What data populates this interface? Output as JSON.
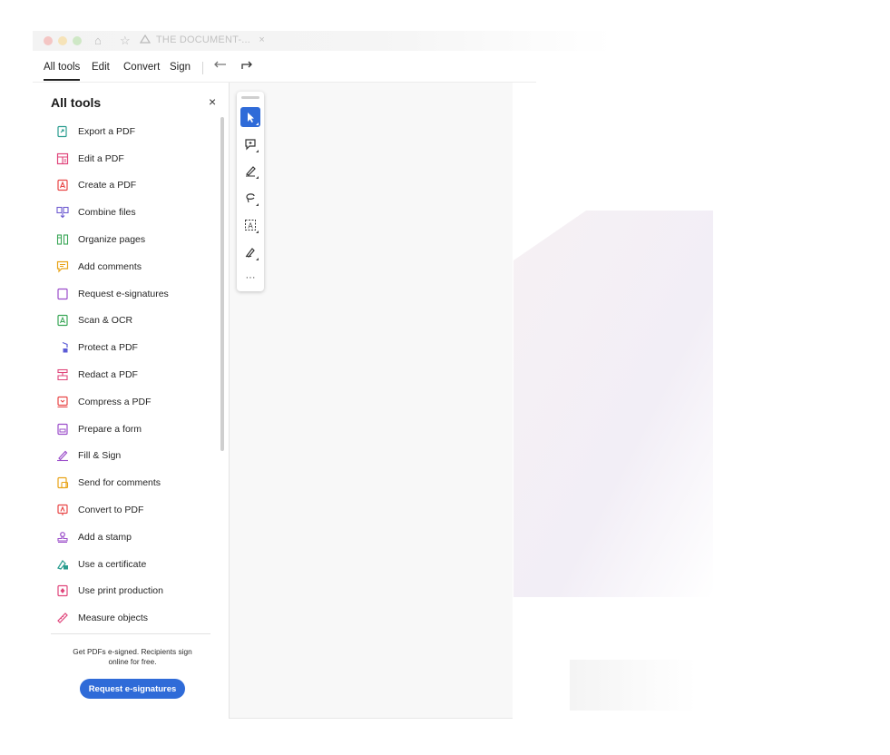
{
  "window": {
    "tab_title": "THE DOCUMENT-...",
    "tab_close": "×",
    "home_icon": "home-icon",
    "star_icon": "star-icon",
    "cloud_icon": "cloud-icon"
  },
  "menubar": {
    "items": [
      {
        "label": "All tools",
        "active": true
      },
      {
        "label": "Edit",
        "active": false
      },
      {
        "label": "Convert",
        "active": false
      },
      {
        "label": "Sign",
        "active": false
      }
    ],
    "undo_icon": "undo-icon",
    "redo_icon": "redo-icon"
  },
  "panel": {
    "title": "All tools",
    "close": "×",
    "tools": [
      {
        "label": "Export a PDF",
        "icon": "export-pdf-icon",
        "color": "#2a9d8f"
      },
      {
        "label": "Edit a PDF",
        "icon": "edit-pdf-icon",
        "color": "#e0457b"
      },
      {
        "label": "Create a PDF",
        "icon": "create-pdf-icon",
        "color": "#e84545"
      },
      {
        "label": "Combine files",
        "icon": "combine-files-icon",
        "color": "#6d5bd0"
      },
      {
        "label": "Organize pages",
        "icon": "organize-pages-icon",
        "color": "#3aa757"
      },
      {
        "label": "Add comments",
        "icon": "add-comments-icon",
        "color": "#e8a317"
      },
      {
        "label": "Request e-signatures",
        "icon": "request-esignatures-icon",
        "color": "#9b4dca"
      },
      {
        "label": "Scan & OCR",
        "icon": "scan-ocr-icon",
        "color": "#3aa757"
      },
      {
        "label": "Protect a PDF",
        "icon": "protect-pdf-icon",
        "color": "#5b5bd6"
      },
      {
        "label": "Redact a PDF",
        "icon": "redact-pdf-icon",
        "color": "#e0457b"
      },
      {
        "label": "Compress a PDF",
        "icon": "compress-pdf-icon",
        "color": "#e84545"
      },
      {
        "label": "Prepare a form",
        "icon": "prepare-form-icon",
        "color": "#9b4dca"
      },
      {
        "label": "Fill & Sign",
        "icon": "fill-sign-icon",
        "color": "#9b4dca"
      },
      {
        "label": "Send for comments",
        "icon": "send-comments-icon",
        "color": "#e8a317"
      },
      {
        "label": "Convert to PDF",
        "icon": "convert-pdf-icon",
        "color": "#e84545"
      },
      {
        "label": "Add a stamp",
        "icon": "stamp-icon",
        "color": "#9b4dca"
      },
      {
        "label": "Use a certificate",
        "icon": "certificate-icon",
        "color": "#2a9d8f"
      },
      {
        "label": "Use print production",
        "icon": "print-production-icon",
        "color": "#e0457b"
      },
      {
        "label": "Measure objects",
        "icon": "measure-icon",
        "color": "#e0457b"
      }
    ],
    "promo_text": "Get PDFs e-signed. Recipients sign online for free.",
    "promo_button": "Request e-signatures"
  },
  "float_toolbar": {
    "tools": [
      {
        "name": "select-tool",
        "icon": "cursor-icon",
        "selected": true
      },
      {
        "name": "comment-tool",
        "icon": "comment-icon",
        "selected": false
      },
      {
        "name": "draw-tool",
        "icon": "pen-icon",
        "selected": false
      },
      {
        "name": "lasso-tool",
        "icon": "lasso-icon",
        "selected": false
      },
      {
        "name": "text-select-tool",
        "icon": "text-box-icon",
        "selected": false
      },
      {
        "name": "sign-tool",
        "icon": "signature-icon",
        "selected": false
      }
    ],
    "more": "···"
  },
  "colors": {
    "accent": "#2f6bd8",
    "panel_border": "#e3e3e3",
    "doc_bg": "#f8f8f8"
  }
}
